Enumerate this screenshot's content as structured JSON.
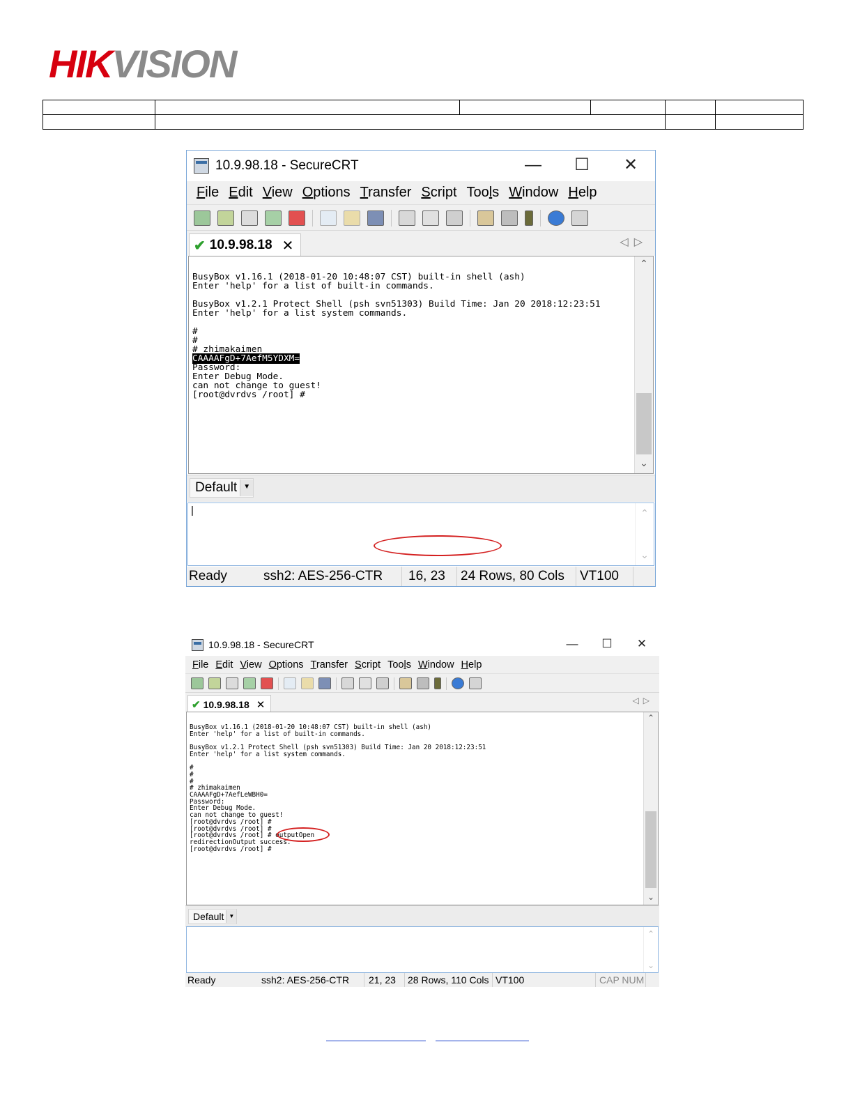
{
  "logo": {
    "text_red": "HIK",
    "text_gray": "VISION"
  },
  "screenshot1": {
    "title": "10.9.98.18 - SecureCRT",
    "window_buttons": [
      "—",
      "☐",
      "✕"
    ],
    "menu": [
      {
        "u": "F",
        "rest": "ile"
      },
      {
        "u": "E",
        "rest": "dit"
      },
      {
        "u": "V",
        "rest": "iew"
      },
      {
        "u": "O",
        "rest": "ptions"
      },
      {
        "u": "T",
        "rest": "ransfer"
      },
      {
        "u": "S",
        "rest": "cript"
      },
      {
        "pre": "Too",
        "u": "l",
        "rest": "s"
      },
      {
        "u": "W",
        "rest": "indow"
      },
      {
        "u": "H",
        "rest": "elp"
      }
    ],
    "tab_label": "10.9.98.18",
    "terminal_lines": [
      "BusyBox v1.16.1 (2018-01-20 10:48:07 CST) built-in shell (ash)",
      "Enter 'help' for a list of built-in commands.",
      "",
      "BusyBox v1.2.1 Protect Shell (psh svn51303) Build Time: Jan 20 2018:12:23:51",
      "Enter 'help' for a list system commands.",
      "",
      "#",
      "#",
      "# zhimakaimen"
    ],
    "highlight_line": "CAAAAFgD+7AefM5YDXM=",
    "terminal_lines_after": [
      "Password:",
      "Enter Debug Mode.",
      "can not change to guest!",
      "[root@dvrdvs /root] #"
    ],
    "session_combo": "Default",
    "command_cursor": "|",
    "status": {
      "ready": "Ready",
      "cipher": "ssh2: AES-256-CTR",
      "position": "16,  23",
      "size": "24 Rows, 80 Cols",
      "term": "VT100"
    }
  },
  "screenshot2": {
    "title": "10.9.98.18 - SecureCRT",
    "window_buttons": [
      "—",
      "☐",
      "✕"
    ],
    "menu": [
      {
        "u": "F",
        "rest": "ile"
      },
      {
        "u": "E",
        "rest": "dit"
      },
      {
        "u": "V",
        "rest": "iew"
      },
      {
        "u": "O",
        "rest": "ptions"
      },
      {
        "u": "T",
        "rest": "ransfer"
      },
      {
        "u": "S",
        "rest": "cript"
      },
      {
        "pre": "Too",
        "u": "l",
        "rest": "s"
      },
      {
        "u": "W",
        "rest": "indow"
      },
      {
        "u": "H",
        "rest": "elp"
      }
    ],
    "tab_label": "10.9.98.18",
    "terminal_text": "BusyBox v1.16.1 (2018-01-20 10:48:07 CST) built-in shell (ash)\nEnter 'help' for a list of built-in commands.\n\nBusyBox v1.2.1 Protect Shell (psh svn51303) Build Time: Jan 20 2018:12:23:51\nEnter 'help' for a list system commands.\n\n#\n#\n#\n# zhimakaimen\nCAAAAFgD+7AefLeWBH0=\nPassword:\nEnter Debug Mode.\ncan not change to guest!\n[root@dvrdvs /root] #\n[root@dvrdvs /root] #\n[root@dvrdvs /root] # outputOpen\nredirectionOutput success.\n[root@dvrdvs /root] #",
    "session_combo": "Default",
    "status": {
      "ready": "Ready",
      "cipher": "ssh2: AES-256-CTR",
      "position": "21,  23",
      "size": "28 Rows, 110 Cols",
      "term": "VT100",
      "caps": "CAP NUM"
    }
  },
  "colors": {
    "brand_red": "#d7000f",
    "annotation_red": "#d42020",
    "link_blue": "#1a3fcc"
  }
}
